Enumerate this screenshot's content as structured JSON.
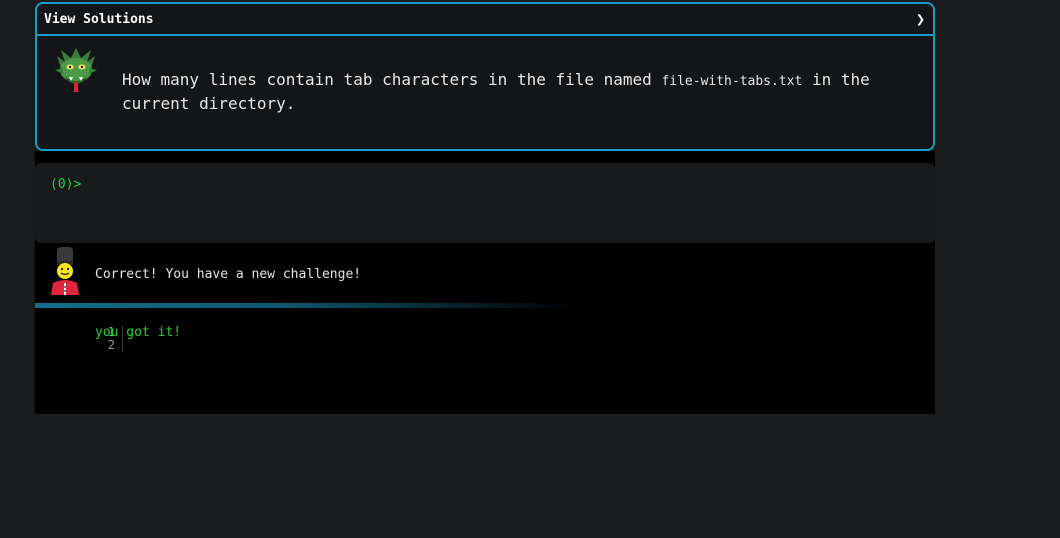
{
  "card": {
    "title": "View Solutions",
    "toggle_icon": "chevron-right-icon",
    "avatar_icon": "dragon-icon",
    "question_before": "How many lines contain tab characters in the file named ",
    "question_code": "file-with-tabs.txt",
    "question_after": " in the current directory."
  },
  "terminal": {
    "prompt": "(0)>"
  },
  "feedback": {
    "avatar_icon": "guard-icon",
    "message": "Correct! You have a new challenge!"
  },
  "output": {
    "line_numbers": [
      "1",
      "2"
    ],
    "lines": [
      "you got it!",
      ""
    ]
  },
  "colors": {
    "accent": "#1a9bc7",
    "prompt_green": "#22d33a",
    "background": "#1a1b1d"
  }
}
